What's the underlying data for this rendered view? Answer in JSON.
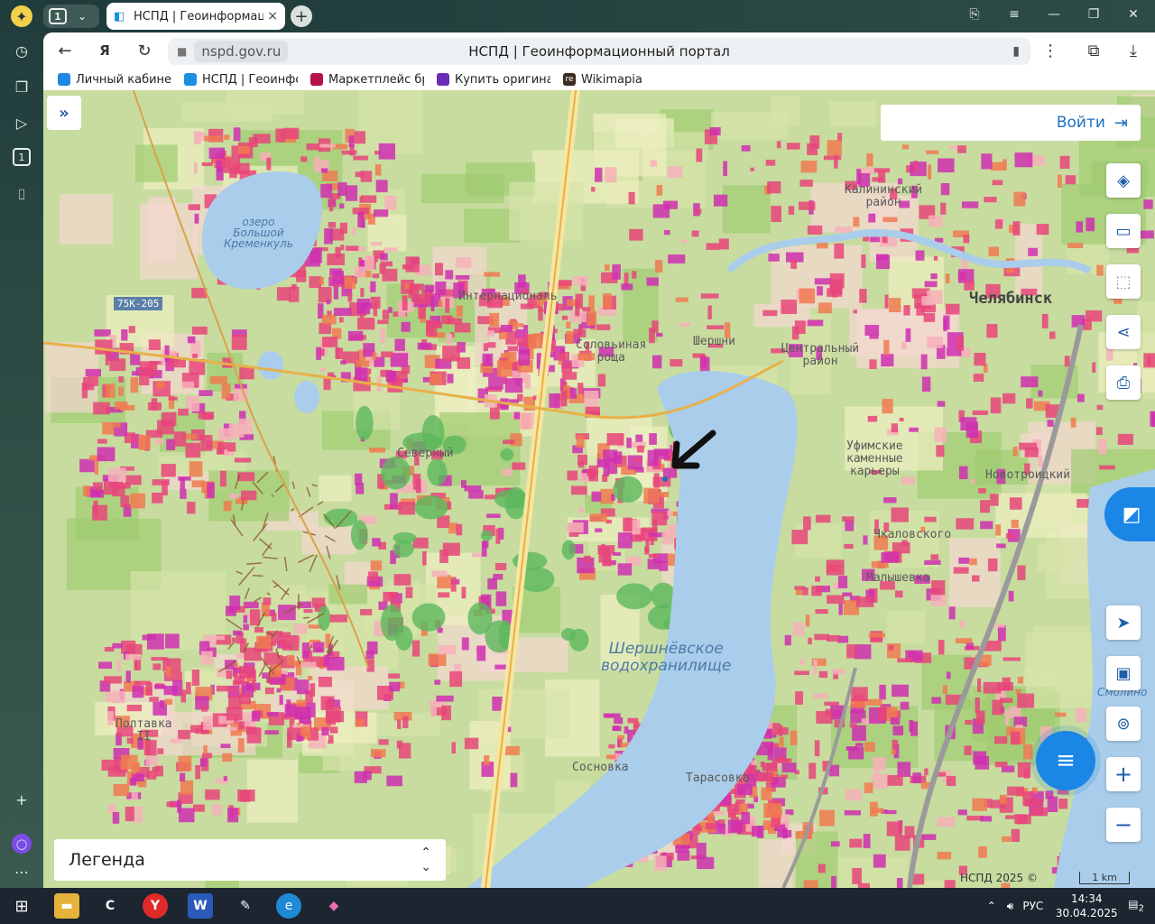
{
  "browser": {
    "tab_count": "1",
    "active_tab_title": "НСПД | Геоинформаци",
    "url_domain": "nspd.gov.ru",
    "page_title": "НСПД | Геоинформационный портал",
    "bookmarks": [
      {
        "label": "Личный кабинет п",
        "icon_color": "#1e88e5"
      },
      {
        "label": "НСПД | Геоинфор",
        "icon_color": "#1d8fe0"
      },
      {
        "label": "Маркетплейс бре",
        "icon_color": "#b3124c"
      },
      {
        "label": "Купить оригинал",
        "icon_color": "#6a2bb8"
      },
      {
        "label": "Wikimapia",
        "icon_color": "#3a2a20",
        "icon_text": "re"
      }
    ]
  },
  "map": {
    "login_label": "Войти",
    "legend_label": "Легенда",
    "copyright": "НСПД 2025 ©",
    "scale_label": "1 km",
    "labels": {
      "lake_name": "озеро\nБольшой\nКременкуль",
      "road_code": "75К-205",
      "reservoir": "Шершнёвское\nводохранилище",
      "chelyabinsk": "Челябинск",
      "central_district": "Центральный\nрайон",
      "kalinin_district": "Калининский\nрайон",
      "ufa_quarries": "Уфимские\nкаменные\nкарьеры",
      "international": "Интернациональ",
      "solovinaya": "Соловьиная\nроща",
      "shershni": "Шершни",
      "malyshevka": "Малышевка",
      "sosnovka": "Сосновка",
      "poltavka": "Полтавка\nII",
      "smolino": "Смолино",
      "tarasovka": "Тарасовка",
      "severo": "Северный",
      "chkalovsky": "Чкаловского",
      "novotroitsky": "Новотроицкий"
    }
  },
  "taskbar": {
    "time": "14:34",
    "date": "30.04.2025",
    "lang": "РУС",
    "notifications": "2"
  },
  "colors": {
    "water": "#a9cdea",
    "forest": "#b9d88a",
    "dense_urban": "#e8457a",
    "magenta": "#cf2fb0",
    "brand_blue": "#1a86e6"
  }
}
